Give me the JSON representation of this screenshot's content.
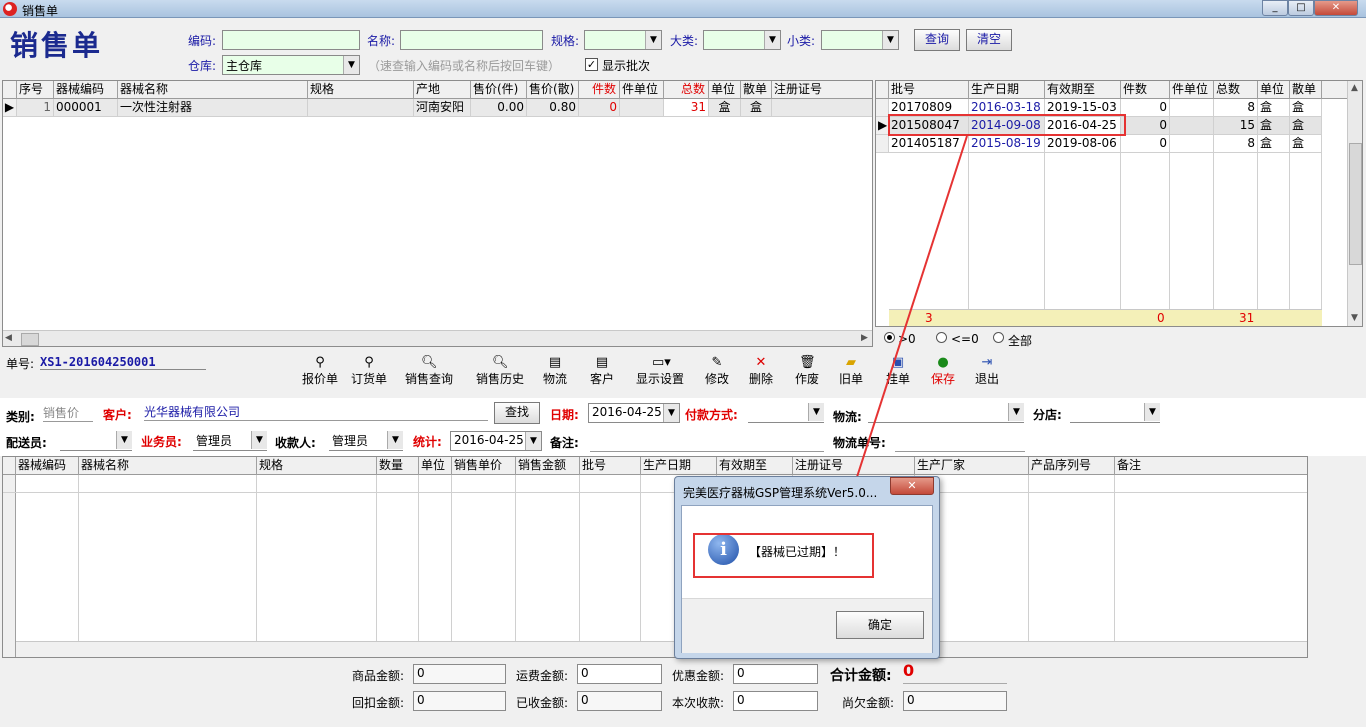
{
  "window": {
    "title": "销售单",
    "min": "_",
    "max": "□",
    "close": "✕"
  },
  "header": {
    "title": "销售单"
  },
  "search": {
    "code_label": "编码:",
    "code_value": "",
    "name_label": "名称:",
    "name_value": "",
    "spec_label": "规格:",
    "spec_value": "",
    "big_cat_label": "大类:",
    "big_cat_value": "",
    "small_cat_label": "小类:",
    "small_cat_value": "",
    "query_btn": "查询",
    "clear_btn": "清空",
    "warehouse_label": "仓库:",
    "warehouse_value": "主仓库",
    "hint": "（速查输入编码或名称后按回车键）",
    "show_batch_label": "显示批次",
    "show_batch_checked": "✓"
  },
  "product_table": {
    "headers": [
      "序号",
      "器械编码",
      "器械名称",
      "规格",
      "产地",
      "售价(件)",
      "售价(散)",
      "件数",
      "件单位",
      "总数",
      "单位",
      "散单",
      "注册证号"
    ],
    "rows": [
      {
        "no": "1",
        "code": "000001",
        "name": "一次性注射器",
        "spec": "",
        "origin": "河南安阳",
        "price_piece": "0.00",
        "price_loose": "0.80",
        "pieces": "0",
        "piece_unit": "",
        "total": "31",
        "unit": "盒",
        "loose_unit": "盒",
        "reg": ""
      }
    ]
  },
  "batch_table": {
    "headers": [
      "批号",
      "生产日期",
      "有效期至",
      "件数",
      "件单位",
      "总数",
      "单位",
      "散单"
    ],
    "rows": [
      {
        "batch": "20170809",
        "prod": "2016-03-18",
        "exp": "2019-15-03",
        "pieces": "0",
        "piece_unit": "",
        "total": "8",
        "unit": "盒",
        "loose": "盒"
      },
      {
        "batch": "201508047",
        "prod": "2014-09-08",
        "exp": "2016-04-25",
        "pieces": "0",
        "piece_unit": "",
        "total": "15",
        "unit": "盒",
        "loose": "盒"
      },
      {
        "batch": "201405187",
        "prod": "2015-08-19",
        "exp": "2019-08-06",
        "pieces": "0",
        "piece_unit": "",
        "total": "8",
        "unit": "盒",
        "loose": "盒"
      }
    ],
    "footer": {
      "count": "3",
      "pieces": "0",
      "total": "31"
    },
    "filter": {
      "opt1": ">0",
      "opt2": "<=0",
      "opt3": "全部"
    }
  },
  "order": {
    "number_label": "单号:",
    "number": "XS1-201604250001"
  },
  "toolbar": {
    "quote": "报价单",
    "order": "订货单",
    "sales_query": "销售查询",
    "sales_history": "销售历史",
    "logistics": "物流",
    "customer": "客户",
    "display_settings": "显示设置",
    "modify": "修改",
    "delete": "删除",
    "void": "作废",
    "old": "旧单",
    "hang": "挂单",
    "save": "保存",
    "exit": "退出"
  },
  "form": {
    "type_label": "类别:",
    "type_value": "销售价",
    "customer_label": "客户:",
    "customer_value": "光华器械有限公司",
    "find_btn": "查找",
    "date_label": "日期:",
    "date_value": "2016-04-25",
    "payment_label": "付款方式:",
    "payment_value": "",
    "logistics_label": "物流:",
    "logistics_value": "",
    "branch_label": "分店:",
    "branch_value": "",
    "delivery_label": "配送员:",
    "delivery_value": "",
    "salesman_label": "业务员:",
    "salesman_value": "管理员",
    "payee_label": "收款人:",
    "payee_value": "管理员",
    "stat_label": "统计:",
    "stat_value": "2016-04-25",
    "remark_label": "备注:",
    "logistics_no_label": "物流单号:"
  },
  "detail_table": {
    "headers": [
      "器械编码",
      "器械名称",
      "规格",
      "数量",
      "单位",
      "销售单价",
      "销售金额",
      "批号",
      "生产日期",
      "有效期至",
      "注册证号",
      "生产厂家",
      "产品序列号",
      "备注"
    ]
  },
  "totals": {
    "goods_label": "商品金额:",
    "goods_value": "0",
    "freight_label": "运费金额:",
    "freight_value": "0",
    "discount_label": "优惠金额:",
    "discount_value": "0",
    "total_label": "合计金额:",
    "total_value": "0",
    "rebate_label": "回扣金额:",
    "rebate_value": "0",
    "received_label": "已收金额:",
    "received_value": "0",
    "this_label": "本次收款:",
    "this_value": "0",
    "owed_label": "尚欠金额:",
    "owed_value": "0"
  },
  "dialog": {
    "title": "完美医疗器械GSP管理系统Ver5.0...",
    "message": "【器械已过期】！",
    "ok": "确定",
    "close": "✕"
  },
  "colors": {
    "annotation_red": "#e53333",
    "title_blue": "#1b2a8f"
  }
}
